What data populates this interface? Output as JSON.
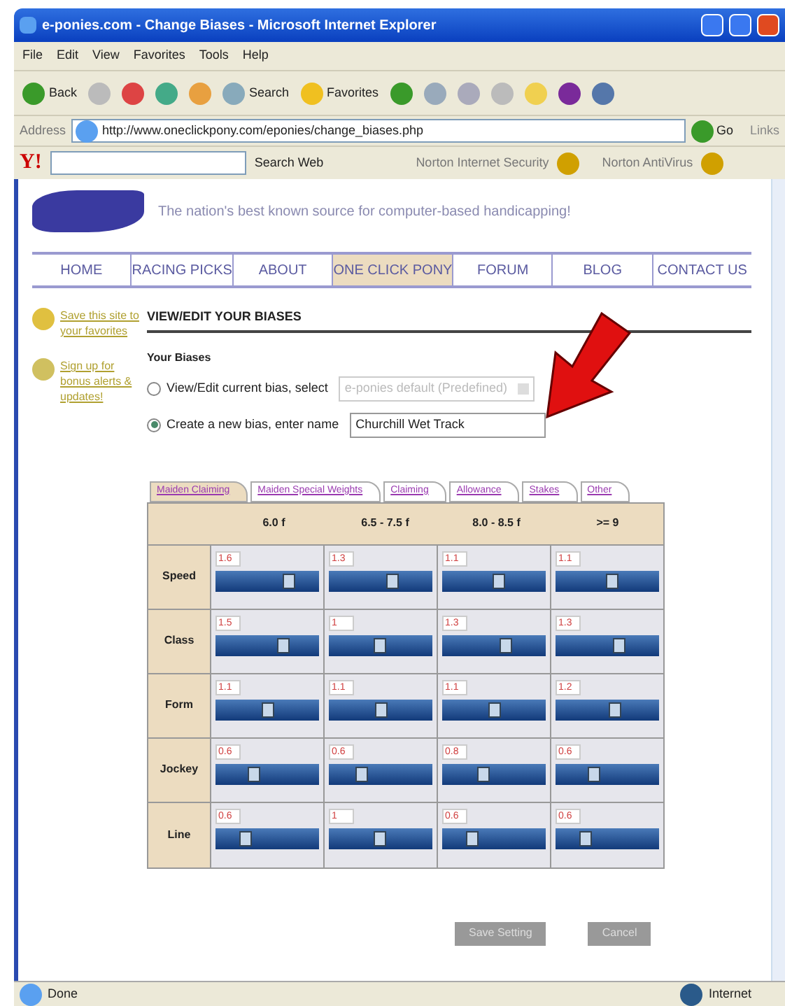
{
  "window": {
    "title": "e-ponies.com - Change Biases - Microsoft Internet Explorer"
  },
  "menu": [
    "File",
    "Edit",
    "View",
    "Favorites",
    "Tools",
    "Help"
  ],
  "toolbar": {
    "back": "Back",
    "search": "Search",
    "favorites": "Favorites"
  },
  "address_bar": {
    "label": "Address",
    "url": "http://www.oneclickpony.com/eponies/change_biases.php",
    "go": "Go",
    "links": "Links"
  },
  "yahoo_bar": {
    "logo": "Y!",
    "search_button": "Search Web",
    "security": "Norton Internet Security",
    "antivirus": "Norton AntiVirus"
  },
  "site": {
    "tagline": "The nation's best known source for computer-based handicapping!",
    "nav": [
      {
        "label": "HOME",
        "selected": false
      },
      {
        "label": "RACING PICKS",
        "selected": false
      },
      {
        "label": "ABOUT",
        "selected": false
      },
      {
        "label": "ONE CLICK PONY",
        "selected": true
      },
      {
        "label": "FORUM",
        "selected": false
      },
      {
        "label": "BLOG",
        "selected": false
      },
      {
        "label": "CONTACT US",
        "selected": false
      }
    ],
    "sidebar": [
      "Save this site to your favorites",
      "Sign up for bonus alerts & updates!"
    ]
  },
  "biases": {
    "heading": "VIEW/EDIT YOUR BIASES",
    "subheading": "Your Biases",
    "options": [
      {
        "label": "View/Edit current bias, select",
        "selected": false,
        "kind": "select",
        "value": "e-ponies default (Predefined)"
      },
      {
        "label": "Create a new bias, enter name",
        "selected": true,
        "kind": "text",
        "value": "Churchill Wet Track"
      }
    ]
  },
  "tabs": [
    {
      "label": "Maiden Claiming",
      "selected": true
    },
    {
      "label": "Maiden Special Weights",
      "selected": false
    },
    {
      "label": "Claiming",
      "selected": false
    },
    {
      "label": "Allowance",
      "selected": false
    },
    {
      "label": "Stakes",
      "selected": false
    },
    {
      "label": "Other",
      "selected": false
    }
  ],
  "table": {
    "columns": [
      "6.0 f",
      "6.5 - 7.5 f",
      "8.0 - 8.5 f",
      ">= 9"
    ],
    "rows": [
      {
        "factor": "Speed",
        "cells": [
          {
            "value": "1.6",
            "level": 0.72
          },
          {
            "value": "1.3",
            "level": 0.62
          },
          {
            "value": "1.1",
            "level": 0.55
          },
          {
            "value": "1.1",
            "level": 0.55
          }
        ]
      },
      {
        "factor": "Class",
        "cells": [
          {
            "value": "1.5",
            "level": 0.66
          },
          {
            "value": "1",
            "level": 0.5
          },
          {
            "value": "1.3",
            "level": 0.62
          },
          {
            "value": "1.3",
            "level": 0.62
          }
        ]
      },
      {
        "factor": "Form",
        "cells": [
          {
            "value": "1.1",
            "level": 0.52
          },
          {
            "value": "1.1",
            "level": 0.52
          },
          {
            "value": "1.1",
            "level": 0.52
          },
          {
            "value": "1.2",
            "level": 0.58
          }
        ]
      },
      {
        "factor": "Jockey",
        "cells": [
          {
            "value": "0.6",
            "level": 0.38
          },
          {
            "value": "0.6",
            "level": 0.32
          },
          {
            "value": "0.8",
            "level": 0.4
          },
          {
            "value": "0.6",
            "level": 0.38
          }
        ]
      },
      {
        "factor": "Line",
        "cells": [
          {
            "value": "0.6",
            "level": 0.3
          },
          {
            "value": "1",
            "level": 0.5
          },
          {
            "value": "0.6",
            "level": 0.3
          },
          {
            "value": "0.6",
            "level": 0.3
          }
        ]
      }
    ]
  },
  "buttons": [
    "Save Setting",
    "Cancel"
  ],
  "status_bar": {
    "status": "Done",
    "zone": "Internet"
  }
}
